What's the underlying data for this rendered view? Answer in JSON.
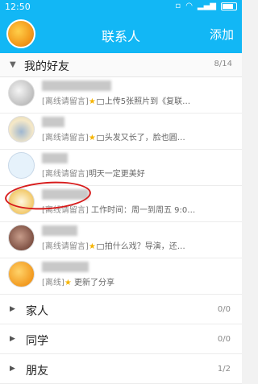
{
  "status_bar": {
    "time": "12:50"
  },
  "header": {
    "title": "联系人",
    "add_label": "添加"
  },
  "my_friends": {
    "name": "我的好友",
    "count": "8/14",
    "items": [
      {
        "tag": "[离线请留言]",
        "status": "上传5张照片到《复联…",
        "star": true,
        "pic": true
      },
      {
        "tag": "[离线请留言]",
        "status": "头发又长了，脸也圆…",
        "star": true,
        "pic": true
      },
      {
        "tag": "[离线请留言]",
        "status": "明天一定更美好",
        "star": false,
        "pic": false
      },
      {
        "tag": "[离线请留言]",
        "status": "工作时间：周一到周五 9:0…",
        "star": false,
        "pic": false
      },
      {
        "tag": "[离线请留言]",
        "status": "拍什么戏？导演，还…",
        "star": true,
        "pic": true
      },
      {
        "tag": "[离线]",
        "status": "更新了分享",
        "star": true,
        "pic": false
      }
    ]
  },
  "groups": [
    {
      "name": "家人",
      "count": "0/0"
    },
    {
      "name": "同学",
      "count": "0/0"
    },
    {
      "name": "朋友",
      "count": "1/2"
    }
  ]
}
